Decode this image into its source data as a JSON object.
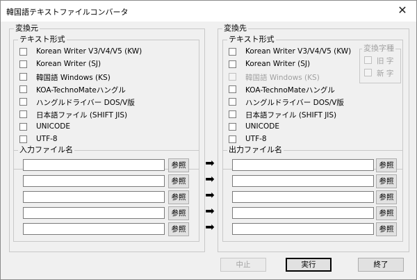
{
  "window": {
    "title": "韓国語テキストファイルコンバータ",
    "close": "✕"
  },
  "source": {
    "title": "変換元",
    "format_group": "テキスト形式",
    "formats": [
      "Korean Writer V3/V4/V5 (KW)",
      "Korean Writer (SJ)",
      "韓国語 Windows (KS)",
      "KOA-TechnoMateハングル",
      "ハングルドライバー DOS/V版",
      "日本語ファイル (SHIFT JIS)",
      "UNICODE",
      "UTF-8"
    ],
    "files_group": "入力ファイル名",
    "browse_label": "参照"
  },
  "dest": {
    "title": "変換先",
    "format_group": "テキスト形式",
    "formats": [
      "Korean Writer V3/V4/V5 (KW)",
      "Korean Writer (SJ)",
      "韓国語 Windows (KS)",
      "KOA-TechnoMateハングル",
      "ハングルドライバー DOS/V版",
      "日本語ファイル (SHIFT JIS)",
      "UNICODE",
      "UTF-8"
    ],
    "char_group": "変換字種",
    "char_options": [
      "旧 字",
      "新 字"
    ],
    "files_group": "出力ファイル名",
    "browse_label": "参照"
  },
  "arrow_glyph": "➡",
  "buttons": {
    "stop": "中止",
    "run": "実行",
    "exit": "終了"
  }
}
